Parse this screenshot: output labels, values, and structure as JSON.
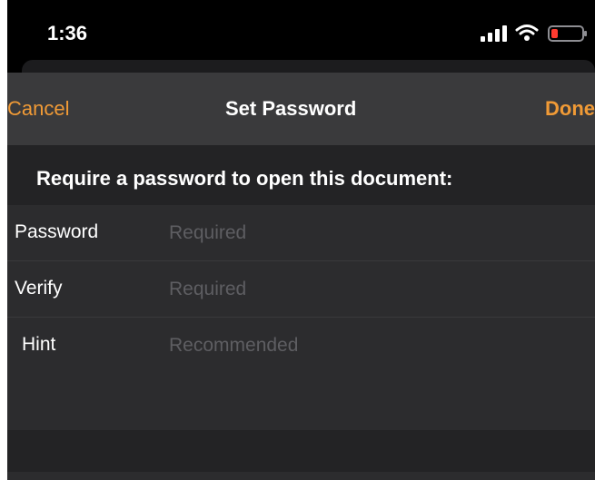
{
  "status_bar": {
    "time": "1:36",
    "icons": [
      "signal-icon",
      "wifi-icon",
      "battery-icon"
    ],
    "battery_color": "#ff3b30"
  },
  "nav": {
    "cancel_label": "Cancel",
    "title": "Set Password",
    "done_label": "Done",
    "accent_color": "#f09a36"
  },
  "section": {
    "header": "Require a password to open this document:"
  },
  "fields": [
    {
      "label": "Password",
      "placeholder": "Required",
      "value": ""
    },
    {
      "label": "Verify",
      "placeholder": "Required",
      "value": ""
    },
    {
      "label": "Hint",
      "placeholder": "Recommended",
      "value": ""
    }
  ]
}
